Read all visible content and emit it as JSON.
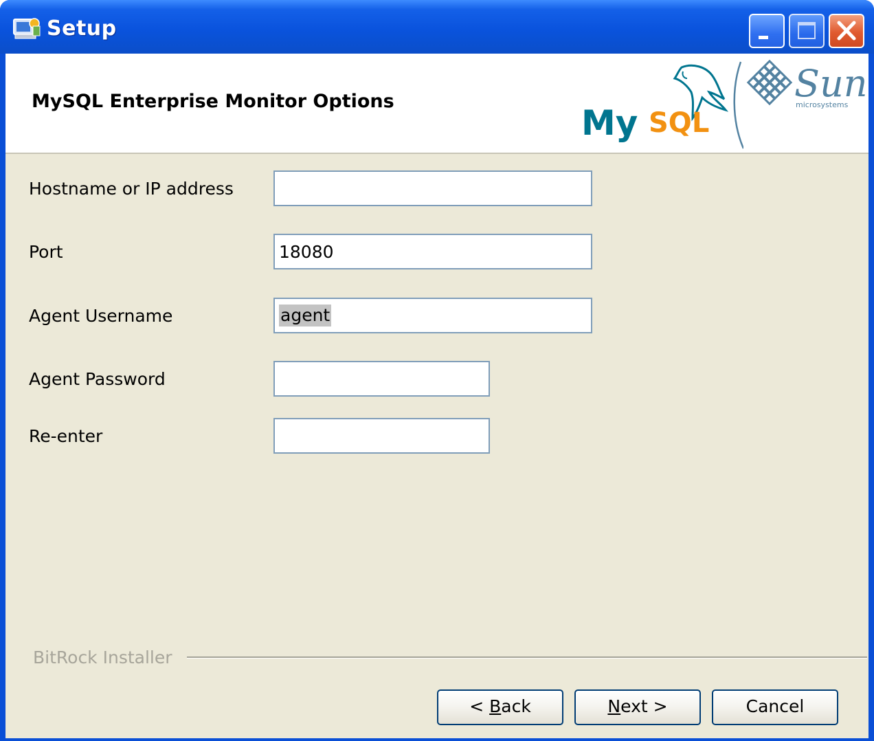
{
  "window": {
    "title": "Setup"
  },
  "header": {
    "page_title": "MySQL Enterprise Monitor Options",
    "logo_mysql": "MySQL",
    "logo_sun": "Sun",
    "logo_sun_sub": "microsystems"
  },
  "form": {
    "hostname_label": "Hostname or IP address",
    "hostname_value": "",
    "port_label": "Port",
    "port_value": "18080",
    "username_label": "Agent Username",
    "username_value": "agent",
    "password_label": "Agent Password",
    "password_value": "",
    "reenter_label": "Re-enter",
    "reenter_value": ""
  },
  "footer": {
    "brand": "BitRock Installer",
    "back_prefix": "< ",
    "back_mnemonic": "B",
    "back_rest": "ack",
    "next_mnemonic": "N",
    "next_rest": "ext >",
    "cancel_label": "Cancel"
  },
  "colors": {
    "titlebar": "#0a53dd",
    "client_bg": "#ece9d8",
    "field_border": "#7f9db9",
    "button_border": "#003c74",
    "mysql_blue": "#00758f",
    "mysql_orange": "#f29111",
    "sun_blue": "#5382a1"
  }
}
